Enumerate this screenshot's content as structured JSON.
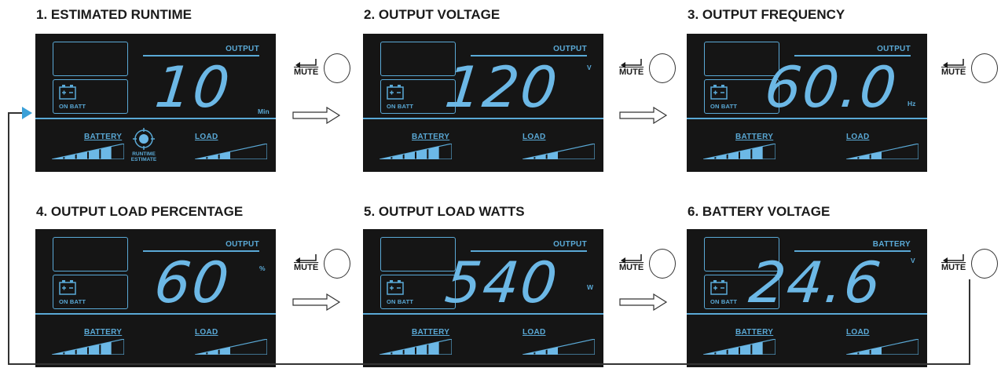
{
  "steps": [
    {
      "title": "1. ESTIMATED RUNTIME",
      "header": "OUTPUT",
      "value": "10",
      "unit": "Min",
      "battery_label": "BATTERY",
      "load_label": "LOAD",
      "on_batt": "ON BATT",
      "extra": "RUNTIME ESTIMATE"
    },
    {
      "title": "2. OUTPUT VOLTAGE",
      "header": "OUTPUT",
      "value": "120",
      "unit": "V",
      "battery_label": "BATTERY",
      "load_label": "LOAD",
      "on_batt": "ON BATT"
    },
    {
      "title": "3. OUTPUT FREQUENCY",
      "header": "OUTPUT",
      "value": "60.0",
      "unit": "Hz",
      "battery_label": "BATTERY",
      "load_label": "LOAD",
      "on_batt": "ON BATT"
    },
    {
      "title": "4. OUTPUT LOAD PERCENTAGE",
      "header": "OUTPUT",
      "value": "60",
      "unit": "%",
      "battery_label": "BATTERY",
      "load_label": "LOAD",
      "on_batt": "ON BATT"
    },
    {
      "title": "5. OUTPUT LOAD WATTS",
      "header": "OUTPUT",
      "value": "540",
      "unit": "W",
      "battery_label": "BATTERY",
      "load_label": "LOAD",
      "on_batt": "ON BATT"
    },
    {
      "title": "6. BATTERY VOLTAGE",
      "header": "BATTERY",
      "value": "24.6",
      "unit": "V",
      "battery_label": "BATTERY",
      "load_label": "LOAD",
      "on_batt": "ON BATT"
    }
  ],
  "mute_label": "MUTE",
  "battery_level_segments": 5,
  "load_level_segments": 3,
  "colors": {
    "lcd_bg": "#151515",
    "lcd_fg": "#6cb8e6",
    "flow_arrow": "#3aa0d8"
  },
  "icons": [
    "battery-icon",
    "enter-arrow-icon",
    "mute-button-icon",
    "right-arrow-icon",
    "runtime-estimate-icon"
  ]
}
